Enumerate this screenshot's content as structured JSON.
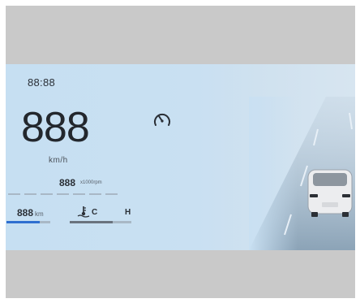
{
  "clock": {
    "time": "88:88"
  },
  "speed": {
    "value": "888",
    "unit": "km/h"
  },
  "tachometer": {
    "value": "888",
    "unit": "x1000rpm"
  },
  "cruise": {
    "icon": "speedometer-gauge-icon"
  },
  "range": {
    "value": "888",
    "unit": "km",
    "level_fraction": 0.75
  },
  "coolant": {
    "icon": "coolant-temperature-icon",
    "cold_label": "C",
    "hot_label": "H",
    "level_fraction": 0.7
  },
  "road_scene": {
    "vehicle_icon": "car-rear-icon"
  },
  "colors": {
    "cluster_background": "#c9e0f2",
    "frame": "#c9c9c9",
    "range_accent": "#2f6fd0",
    "text": "#23272d"
  }
}
